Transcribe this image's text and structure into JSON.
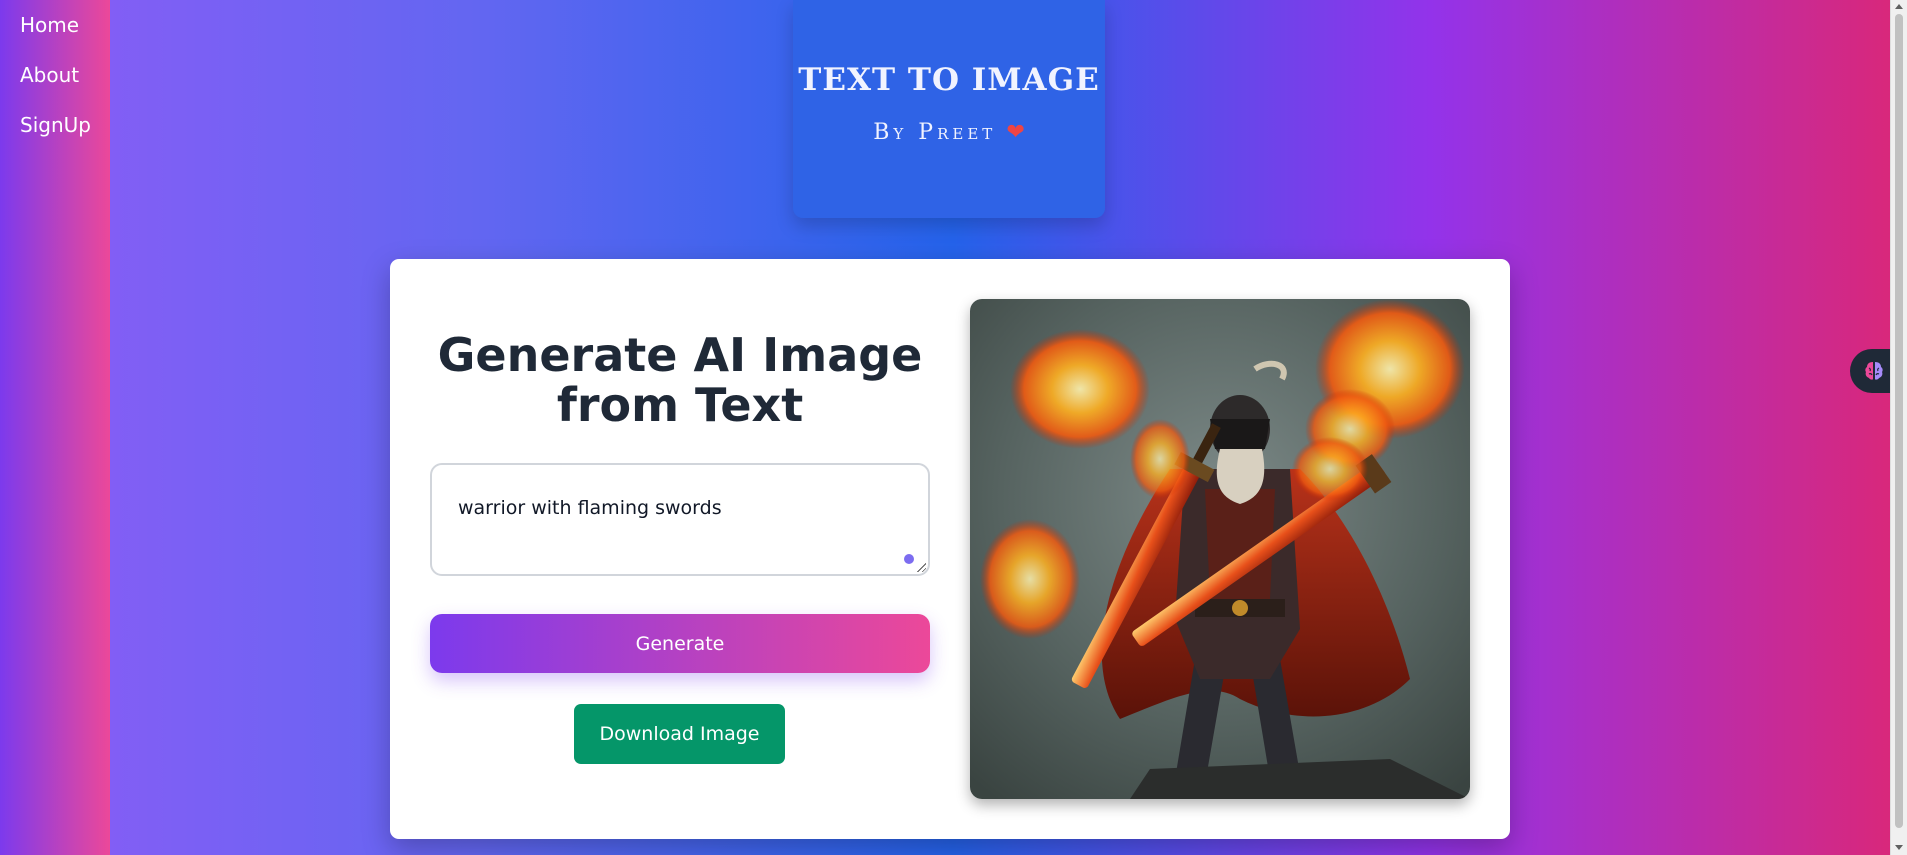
{
  "nav": {
    "items": [
      {
        "label": "Home"
      },
      {
        "label": "About"
      },
      {
        "label": "SignUp"
      }
    ]
  },
  "header": {
    "title": "TEXT TO IMAGE",
    "subtitle": "By Preet",
    "heart": "❤"
  },
  "main": {
    "heading_line1": "Generate AI Image",
    "heading_line2": "from Text",
    "prompt": {
      "value": "warrior with flaming swords"
    },
    "generate_label": "Generate",
    "download_label": "Download Image"
  },
  "colors": {
    "generate_gradient_start": "#7c3aed",
    "generate_gradient_end": "#ec4899",
    "download_button": "#059669",
    "header_card": "#2f63e6"
  },
  "icons": {
    "extension_tab": "brain-icon",
    "grammar_indicator": "grammar-dot-icon"
  }
}
